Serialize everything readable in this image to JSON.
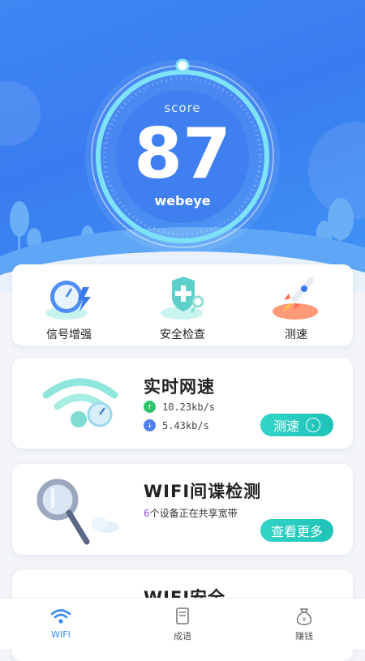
{
  "hero": {
    "score_label": "score",
    "score_value": "87",
    "brand": "webeye"
  },
  "tools": [
    {
      "label": "信号增强",
      "icon": "speedometer-lightning-icon"
    },
    {
      "label": "安全检查",
      "icon": "shield-plus-icon"
    },
    {
      "label": "测速",
      "icon": "rocket-icon"
    }
  ],
  "speed_card": {
    "title": "实时网速",
    "upload": "10.23kb/s",
    "download": "5.43kb/s",
    "button": "测速"
  },
  "spy_card": {
    "title": "WIFI间谍检测",
    "count": "6",
    "desc": "个设备正在共享宽带",
    "button": "查看更多"
  },
  "security_card": {
    "title": "WIFI安全"
  },
  "tabs": [
    {
      "label": "WIFI",
      "icon": "wifi-icon",
      "active": true
    },
    {
      "label": "成语",
      "icon": "book-icon",
      "active": false
    },
    {
      "label": "赚钱",
      "icon": "money-bag-icon",
      "active": false
    }
  ],
  "colors": {
    "primary": "#3a7cf0",
    "accent": "#1ec2b6",
    "upload": "#2fc56a",
    "download": "#4f7ff0"
  }
}
